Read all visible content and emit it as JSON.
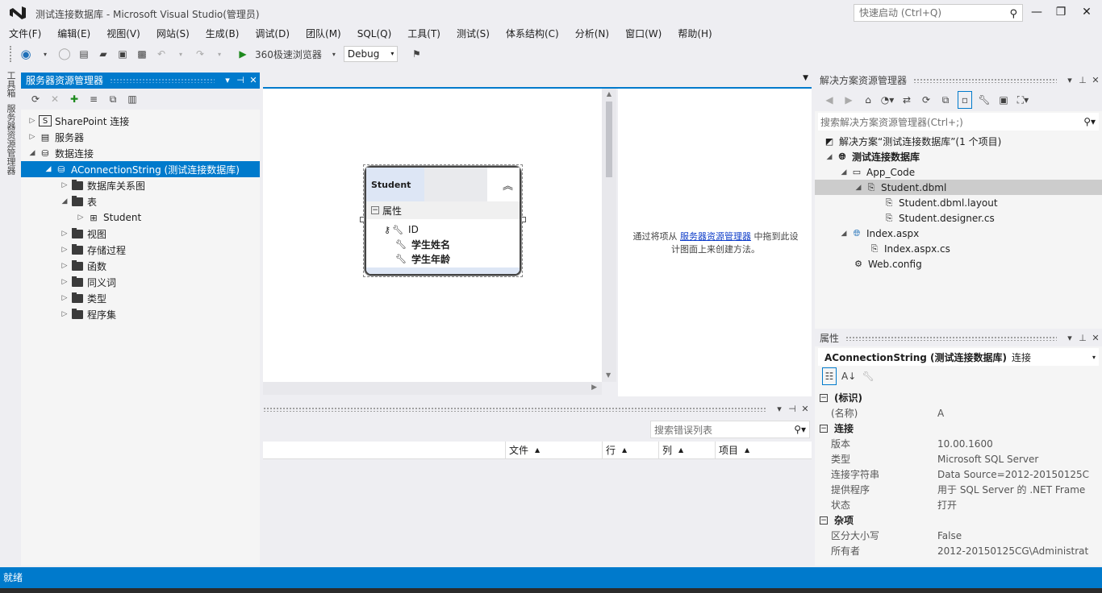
{
  "window": {
    "title": "测试连接数据库 - Microsoft Visual Studio(管理员)",
    "quick_launch_placeholder": "快速启动 (Ctrl+Q)"
  },
  "menu": [
    "文件(F)",
    "编辑(E)",
    "视图(V)",
    "网站(S)",
    "生成(B)",
    "调试(D)",
    "团队(M)",
    "SQL(Q)",
    "工具(T)",
    "测试(S)",
    "体系结构(C)",
    "分析(N)",
    "窗口(W)",
    "帮助(H)"
  ],
  "toolbar": {
    "run_label": "360极速浏览器",
    "config_value": "Debug"
  },
  "left_strip": {
    "toolbox_tab": "工具箱",
    "server_explorer_tab": "服务器资源管理器"
  },
  "server_explorer": {
    "title": "服务器资源管理器",
    "nodes": {
      "sharepoint": "SharePoint 连接",
      "servers": "服务器",
      "data_connections": "数据连接",
      "connection": "AConnectionString (测试连接数据库)",
      "diagrams": "数据库关系图",
      "tables": "表",
      "student": "Student",
      "views": "视图",
      "procs": "存储过程",
      "functions": "函数",
      "synonyms": "同义词",
      "types": "类型",
      "assemblies": "程序集"
    }
  },
  "designer": {
    "entity_name": "Student",
    "section_label": "属性",
    "fields": [
      "ID",
      "学生姓名",
      "学生年龄"
    ],
    "hint_prefix": "通过将项从",
    "hint_link": "服务器资源管理器",
    "hint_mid": "中拖到此设",
    "hint_suffix": "计图面上来创建方法。"
  },
  "error_list": {
    "search_placeholder": "搜索错误列表",
    "columns": [
      "文件",
      "行",
      "列",
      "项目"
    ]
  },
  "solution_explorer": {
    "title": "解决方案资源管理器",
    "search_placeholder": "搜索解决方案资源管理器(Ctrl+;)",
    "solution": "解决方案“测试连接数据库”(1 个项目)",
    "project": "测试连接数据库",
    "app_code": "App_Code",
    "dbml": "Student.dbml",
    "layout": "Student.dbml.layout",
    "designer_cs": "Student.designer.cs",
    "index": "Index.aspx",
    "index_cs": "Index.aspx.cs",
    "webconfig": "Web.config"
  },
  "properties": {
    "title": "属性",
    "object_name": "AConnectionString (测试连接数据库)",
    "object_type": "连接",
    "categories": [
      {
        "name": "(标识)",
        "rows": [
          {
            "k": "(名称)",
            "v": "A"
          }
        ]
      },
      {
        "name": "连接",
        "rows": [
          {
            "k": "版本",
            "v": "10.00.1600"
          },
          {
            "k": "类型",
            "v": "Microsoft SQL Server"
          },
          {
            "k": "连接字符串",
            "v": "Data Source=2012-20150125C"
          },
          {
            "k": "提供程序",
            "v": "用于 SQL Server 的 .NET Frame"
          },
          {
            "k": "状态",
            "v": "打开"
          }
        ]
      },
      {
        "name": "杂项",
        "rows": [
          {
            "k": "区分大小写",
            "v": "False"
          },
          {
            "k": "所有者",
            "v": "2012-20150125CG\\Administrat"
          }
        ]
      }
    ]
  },
  "status": {
    "text": "就绪"
  },
  "colors": {
    "accent": "#007acc",
    "chrome": "#eeeef2"
  }
}
